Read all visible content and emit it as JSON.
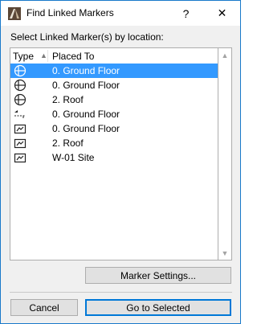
{
  "window": {
    "title": "Find Linked Markers",
    "help_glyph": "?",
    "close_glyph": "✕"
  },
  "prompt": "Select Linked Marker(s) by location:",
  "list": {
    "columns": {
      "type": "Type",
      "placed_to": "Placed To"
    },
    "sort_glyph": "▲",
    "rows": [
      {
        "icon": "section-marker-icon",
        "placed_to": "0. Ground Floor",
        "selected": true
      },
      {
        "icon": "section-marker-icon",
        "placed_to": "0. Ground Floor",
        "selected": false
      },
      {
        "icon": "section-marker-icon",
        "placed_to": "2. Roof",
        "selected": false
      },
      {
        "icon": "elevation-marker-icon",
        "placed_to": "0. Ground Floor",
        "selected": false
      },
      {
        "icon": "worksheet-marker-icon",
        "placed_to": "0. Ground Floor",
        "selected": false
      },
      {
        "icon": "worksheet-marker-icon",
        "placed_to": "2. Roof",
        "selected": false
      },
      {
        "icon": "worksheet-marker-icon",
        "placed_to": "W-01 Site",
        "selected": false
      }
    ]
  },
  "scrollbar": {
    "up_glyph": "▲",
    "down_glyph": "▼"
  },
  "buttons": {
    "marker_settings": "Marker Settings...",
    "cancel": "Cancel",
    "go_to_selected": "Go to Selected"
  },
  "colors": {
    "selection": "#3399ff",
    "window_border": "#1979ca",
    "default_button_border": "#0078d7"
  }
}
